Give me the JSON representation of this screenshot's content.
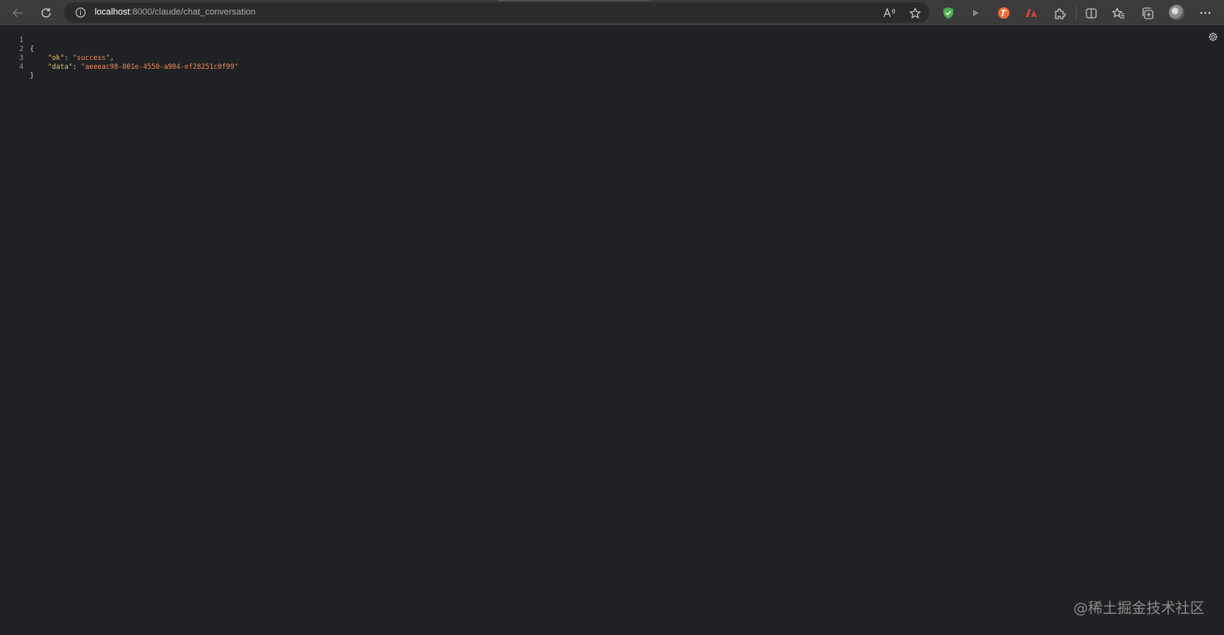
{
  "browser": {
    "url": {
      "host": "localhost",
      "path": ":8000/claude/chat_conversation"
    },
    "icons": {
      "back": "back-arrow-icon",
      "refresh": "refresh-icon",
      "site_info": "info-icon",
      "read_aloud": "read-aloud-icon",
      "favorite": "star-icon",
      "ext_shield": "shield-extension-icon",
      "ext_play": "play-extension-icon",
      "ext_translate": "translate-extension-icon",
      "ext_adobe": "adobe-extension-icon",
      "extensions": "puzzle-icon",
      "split_screen": "split-screen-icon",
      "favorites": "favorites-icon",
      "collections": "collections-icon",
      "profile": "avatar",
      "more": "more-icon"
    },
    "colors": {
      "shield": "#4caf50",
      "translate": "#f26b3a",
      "adobe": "#e5483b"
    }
  },
  "json_viewer": {
    "lines": [
      {
        "number": "1",
        "open": "{"
      },
      {
        "number": "2",
        "key": "\"ok\"",
        "sep": ": ",
        "value": "\"success\"",
        "trail": ","
      },
      {
        "number": "3",
        "key": "\"data\"",
        "sep": ": ",
        "value": "\"aeeeac98-001e-4550-a984-ef28251c0f99\"",
        "trail": ""
      },
      {
        "number": "4",
        "close": "}"
      }
    ],
    "settings_icon": "gear-icon"
  },
  "watermark": "@稀土掘金技术社区"
}
